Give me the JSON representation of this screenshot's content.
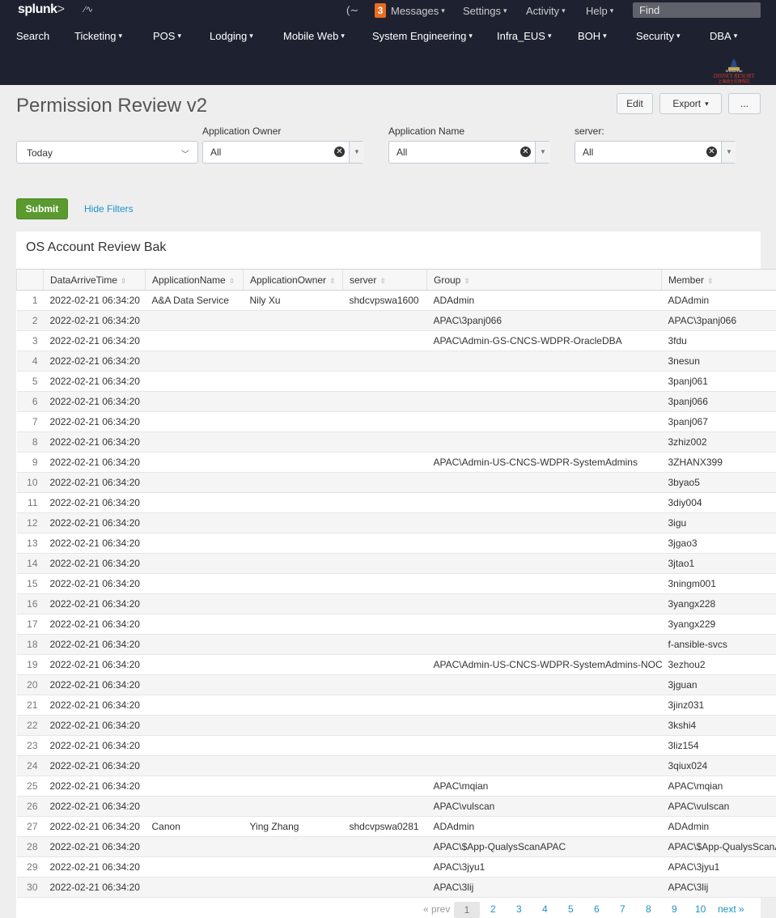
{
  "topbar": {
    "logo": "splunk",
    "logo_gt": ">",
    "activity_mini": "⁄∿",
    "menu_search_icon": "(∼",
    "messages_count": "3",
    "messages": "Messages",
    "settings": "Settings",
    "activity": "Activity",
    "help": "Help",
    "find": "Find"
  },
  "appnav": [
    "Search",
    "Ticketing",
    "POS",
    "Lodging",
    "Mobile Web",
    "System Engineering",
    "Infra_EUS",
    "BOH",
    "Security",
    "DBA"
  ],
  "logo_text": {
    "line1": "SHANGHAI",
    "line2": "DISNEY RESORT",
    "line3": "上海迪士尼度假区"
  },
  "page": {
    "title": "Permission Review v2",
    "edit": "Edit",
    "export": "Export",
    "more": "..."
  },
  "filters": {
    "time": "Today",
    "owner_label": "Application Owner",
    "owner_value": "All",
    "name_label": "Application Name",
    "name_value": "All",
    "server_label": "server:",
    "server_value": "All",
    "submit": "Submit",
    "hide": "Hide Filters"
  },
  "panel": {
    "title": "OS Account Review Bak",
    "columns": [
      "DataArriveTime",
      "ApplicationName",
      "ApplicationOwner",
      "server",
      "Group",
      "Member"
    ],
    "rows": [
      [
        "1",
        "2022-02-21 06:34:20",
        "A&A Data Service",
        "Nily Xu",
        "shdcvpswa1600",
        "ADAdmin",
        "ADAdmin"
      ],
      [
        "2",
        "2022-02-21 06:34:20",
        "",
        "",
        "",
        "APAC\\3panj066",
        "APAC\\3panj066"
      ],
      [
        "3",
        "2022-02-21 06:34:20",
        "",
        "",
        "",
        "APAC\\Admin-GS-CNCS-WDPR-OracleDBA",
        "3fdu"
      ],
      [
        "4",
        "2022-02-21 06:34:20",
        "",
        "",
        "",
        "",
        "3nesun"
      ],
      [
        "5",
        "2022-02-21 06:34:20",
        "",
        "",
        "",
        "",
        "3panj061"
      ],
      [
        "6",
        "2022-02-21 06:34:20",
        "",
        "",
        "",
        "",
        "3panj066"
      ],
      [
        "7",
        "2022-02-21 06:34:20",
        "",
        "",
        "",
        "",
        "3panj067"
      ],
      [
        "8",
        "2022-02-21 06:34:20",
        "",
        "",
        "",
        "",
        "3zhiz002"
      ],
      [
        "9",
        "2022-02-21 06:34:20",
        "",
        "",
        "",
        "APAC\\Admin-US-CNCS-WDPR-SystemAdmins",
        "3ZHANX399"
      ],
      [
        "10",
        "2022-02-21 06:34:20",
        "",
        "",
        "",
        "",
        "3byao5"
      ],
      [
        "11",
        "2022-02-21 06:34:20",
        "",
        "",
        "",
        "",
        "3diy004"
      ],
      [
        "12",
        "2022-02-21 06:34:20",
        "",
        "",
        "",
        "",
        "3igu"
      ],
      [
        "13",
        "2022-02-21 06:34:20",
        "",
        "",
        "",
        "",
        "3jgao3"
      ],
      [
        "14",
        "2022-02-21 06:34:20",
        "",
        "",
        "",
        "",
        "3jtao1"
      ],
      [
        "15",
        "2022-02-21 06:34:20",
        "",
        "",
        "",
        "",
        "3ningm001"
      ],
      [
        "16",
        "2022-02-21 06:34:20",
        "",
        "",
        "",
        "",
        "3yangx228"
      ],
      [
        "17",
        "2022-02-21 06:34:20",
        "",
        "",
        "",
        "",
        "3yangx229"
      ],
      [
        "18",
        "2022-02-21 06:34:20",
        "",
        "",
        "",
        "",
        "f-ansible-svcs"
      ],
      [
        "19",
        "2022-02-21 06:34:20",
        "",
        "",
        "",
        "APAC\\Admin-US-CNCS-WDPR-SystemAdmins-NOC",
        "3ezhou2"
      ],
      [
        "20",
        "2022-02-21 06:34:20",
        "",
        "",
        "",
        "",
        "3jguan"
      ],
      [
        "21",
        "2022-02-21 06:34:20",
        "",
        "",
        "",
        "",
        "3jinz031"
      ],
      [
        "22",
        "2022-02-21 06:34:20",
        "",
        "",
        "",
        "",
        "3kshi4"
      ],
      [
        "23",
        "2022-02-21 06:34:20",
        "",
        "",
        "",
        "",
        "3liz154"
      ],
      [
        "24",
        "2022-02-21 06:34:20",
        "",
        "",
        "",
        "",
        "3qiux024"
      ],
      [
        "25",
        "2022-02-21 06:34:20",
        "",
        "",
        "",
        "APAC\\mqian",
        "APAC\\mqian"
      ],
      [
        "26",
        "2022-02-21 06:34:20",
        "",
        "",
        "",
        "APAC\\vulscan",
        "APAC\\vulscan"
      ],
      [
        "27",
        "2022-02-21 06:34:20",
        "Canon",
        "Ying Zhang",
        "shdcvpswa0281",
        "ADAdmin",
        "ADAdmin"
      ],
      [
        "28",
        "2022-02-21 06:34:20",
        "",
        "",
        "",
        "APAC\\$App-QualysScanAPAC",
        "APAC\\$App-QualysScanAPAC"
      ],
      [
        "29",
        "2022-02-21 06:34:20",
        "",
        "",
        "",
        "APAC\\3jyu1",
        "APAC\\3jyu1"
      ],
      [
        "30",
        "2022-02-21 06:34:20",
        "",
        "",
        "",
        "APAC\\3lij",
        "APAC\\3lij"
      ]
    ]
  },
  "pager": {
    "prev": "« prev",
    "pages": [
      "1",
      "2",
      "3",
      "4",
      "5",
      "6",
      "7",
      "8",
      "9",
      "10"
    ],
    "next": "next »"
  }
}
